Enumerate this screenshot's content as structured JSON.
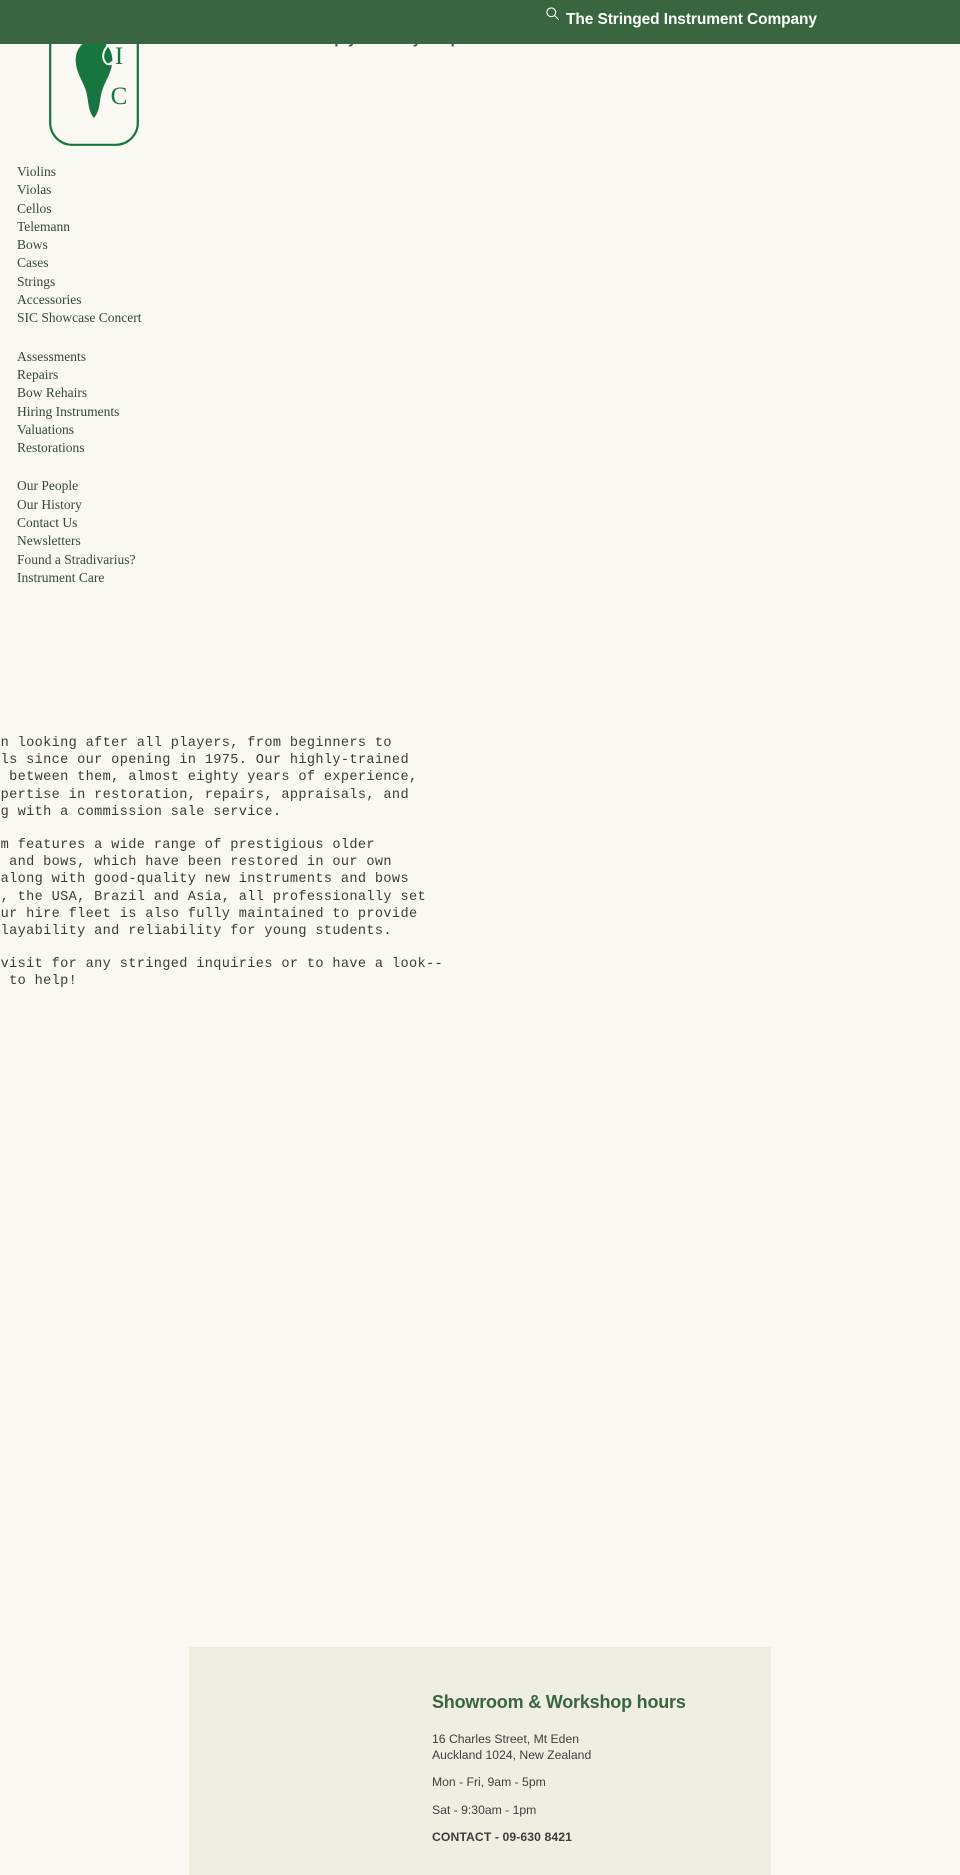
{
  "header": {
    "title": "The Stringed Instrument Company",
    "search_icon": "search-icon",
    "bar_color": "#39653F"
  },
  "hero": {
    "tagline": "We are here to help you find your perfect instrument."
  },
  "logo": {
    "letters": [
      "S",
      "I",
      "C"
    ],
    "alt": "SIC violin logo",
    "color": "#17763F"
  },
  "sidebar": {
    "groups": [
      {
        "items": [
          {
            "label": "Violins"
          },
          {
            "label": "Violas"
          },
          {
            "label": "Cellos"
          },
          {
            "label": "Telemann"
          },
          {
            "label": "Bows"
          },
          {
            "label": "Cases"
          },
          {
            "label": "Strings"
          },
          {
            "label": "Accessories"
          },
          {
            "label": "SIC Showcase Concert"
          }
        ]
      },
      {
        "items": [
          {
            "label": "Assessments"
          },
          {
            "label": "Repairs"
          },
          {
            "label": "Bow Rehairs"
          },
          {
            "label": "Hiring Instruments"
          },
          {
            "label": "Valuations"
          },
          {
            "label": "Restorations"
          }
        ]
      },
      {
        "items": [
          {
            "label": "Our People"
          },
          {
            "label": "Our History"
          },
          {
            "label": "Contact Us"
          },
          {
            "label": "Newsletters"
          },
          {
            "label": "Found a Stradivarius?"
          },
          {
            "label": "Instrument Care"
          }
        ]
      }
    ]
  },
  "main": {
    "paragraphs": [
      "We have been looking after all players, from beginners to professionals since our opening in 1975. Our highly-trained staff have, between them, almost eighty years of experience, offering expertise in restoration, repairs, appraisals, and sales, along with a commission sale service.",
      "Our showroom features a wide range of prestigious older instruments and bows, which have been restored in our own workshops, along with good-quality new instruments and bows from Europe, the USA, Brazil and Asia, all professionally set up by us. Our hire fleet is also fully maintained to provide excellent playability and reliability for young students.",
      "Come in to visit for any stringed inquiries or to have a look--we are here to help!"
    ]
  },
  "footer": {
    "heading": "Showroom & Workshop hours",
    "address_line1": "16 Charles Street, Mt Eden",
    "address_line2": "Auckland 1024, New Zealand",
    "hours_weekday": "Mon - Fri, 9am - 5pm",
    "hours_saturday": "Sat - 9:30am - 1pm",
    "contact": "CONTACT - 09-630 8421",
    "panel_color": "#F0EEE3"
  }
}
